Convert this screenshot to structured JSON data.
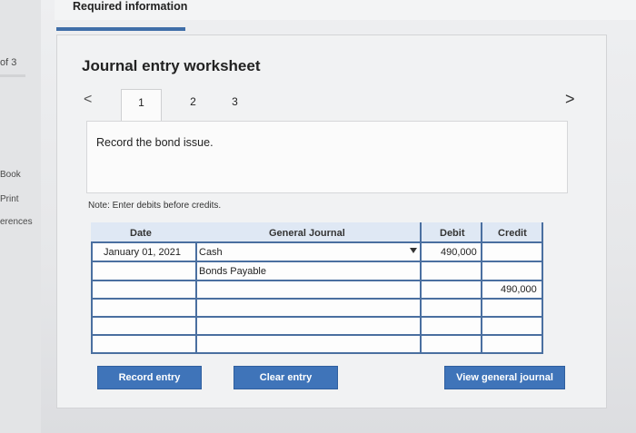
{
  "sidebar": {
    "page_indicator": "of 3",
    "book": "Book",
    "print": "Print",
    "references": "erences"
  },
  "header": {
    "required_info": "Required information"
  },
  "worksheet": {
    "title": "Journal entry worksheet",
    "tabs": [
      "1",
      "2",
      "3"
    ],
    "active_tab": "1",
    "prev_glyph": "<",
    "next_glyph": ">",
    "instruction": "Record the bond issue.",
    "note": "Note: Enter debits before credits."
  },
  "table": {
    "headers": {
      "date": "Date",
      "general_journal": "General Journal",
      "debit": "Debit",
      "credit": "Credit"
    },
    "rows": [
      {
        "date": "January 01, 2021",
        "account": "Cash",
        "debit": "490,000",
        "credit": ""
      },
      {
        "date": "",
        "account": "Bonds Payable",
        "debit": "",
        "credit": ""
      },
      {
        "date": "",
        "account": "",
        "debit": "",
        "credit": "490,000"
      },
      {
        "date": "",
        "account": "",
        "debit": "",
        "credit": ""
      },
      {
        "date": "",
        "account": "",
        "debit": "",
        "credit": ""
      },
      {
        "date": "",
        "account": "",
        "debit": "",
        "credit": ""
      }
    ]
  },
  "buttons": {
    "record": "Record entry",
    "clear": "Clear entry",
    "view": "View general journal"
  },
  "colors": {
    "accent": "#3f74b9",
    "grid": "#4a6fa0",
    "header_bg": "#dfe8f4"
  }
}
